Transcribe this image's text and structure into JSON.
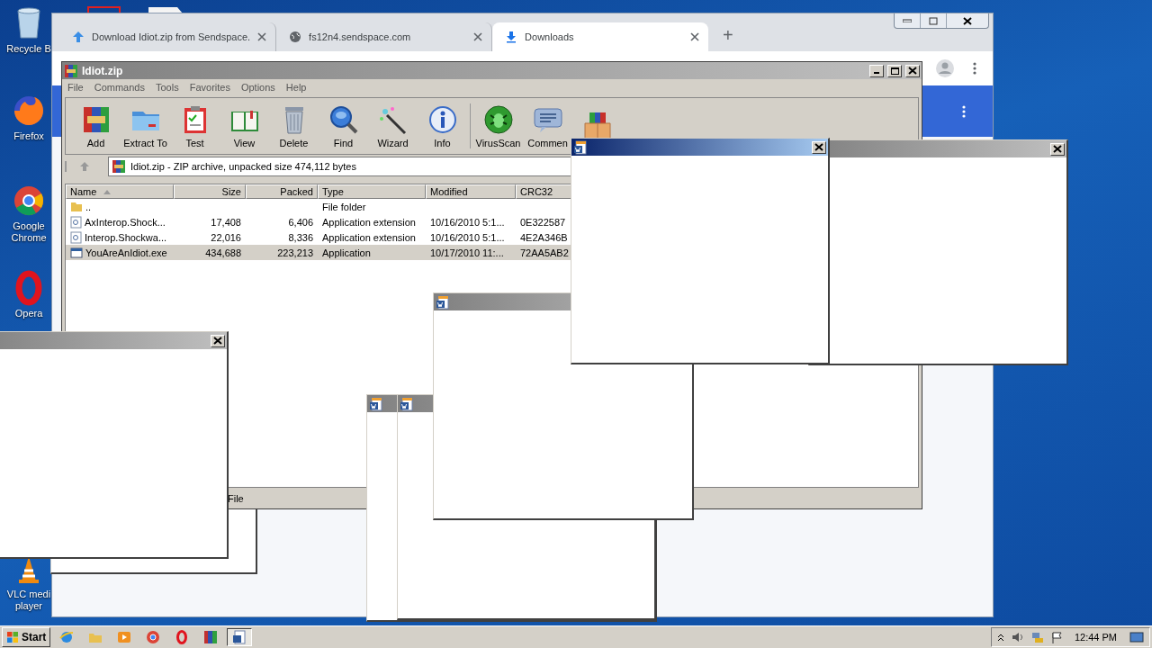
{
  "desktop_icons": [
    {
      "label": "Recycle B"
    },
    {
      "label": "Firefox"
    },
    {
      "label": "Google\nChrome"
    },
    {
      "label": "Opera"
    },
    {
      "label": "VLC medi\nplayer"
    }
  ],
  "browser": {
    "tabs": [
      {
        "title": "Download Idiot.zip from Sendspace.",
        "selected": false
      },
      {
        "title": "fs12n4.sendspace.com",
        "selected": false
      },
      {
        "title": "Downloads",
        "selected": true
      }
    ],
    "new_tab": "+"
  },
  "archiver": {
    "title": "Idiot.zip",
    "menu": [
      "File",
      "Commands",
      "Tools",
      "Favorites",
      "Options",
      "Help"
    ],
    "toolbar": [
      {
        "label": "Add"
      },
      {
        "label": "Extract To"
      },
      {
        "label": "Test"
      },
      {
        "label": "View"
      },
      {
        "label": "Delete"
      },
      {
        "label": "Find"
      },
      {
        "label": "Wizard"
      },
      {
        "label": "Info"
      },
      {
        "label": "VirusScan"
      },
      {
        "label": "Commen"
      },
      {
        "kind": "icon-only"
      }
    ],
    "path": "Idiot.zip - ZIP archive, unpacked size 474,112 bytes",
    "columns": [
      {
        "label": "Name",
        "sorted": true
      },
      {
        "label": "Size",
        "sorted": false
      },
      {
        "label": "Packed",
        "sorted": false
      },
      {
        "label": "Type",
        "sorted": false
      },
      {
        "label": "Modified",
        "sorted": false
      },
      {
        "label": "CRC32",
        "sorted": false
      }
    ],
    "rows": [
      {
        "kind": "folder",
        "name": "..",
        "type": "File folder",
        "selected": false
      },
      {
        "kind": "dll",
        "name": "AxInterop.Shock...",
        "size": "17,408",
        "packed": "6,406",
        "type": "Application extension",
        "modified": "10/16/2010 5:1...",
        "crc": "0E322587",
        "selected": false
      },
      {
        "kind": "dll",
        "name": "Interop.Shockwa...",
        "size": "22,016",
        "packed": "8,336",
        "type": "Application extension",
        "modified": "10/16/2010 5:1...",
        "crc": "4E2A346B",
        "selected": false
      },
      {
        "kind": "exe",
        "name": "YouAreAnIdiot.exe",
        "size": "434,688",
        "packed": "223,213",
        "type": "Application",
        "modified": "10/17/2010 11:...",
        "crc": "72AA5AB2",
        "selected": true
      }
    ],
    "status": "File"
  },
  "popups": [
    {
      "active": false
    },
    {
      "active": false
    },
    {
      "active": false
    },
    {
      "active": false
    },
    {
      "active": false
    },
    {
      "active": true
    }
  ],
  "taskbar": {
    "start": "Start",
    "items": [
      {
        "selected": false
      },
      {
        "selected": false
      },
      {
        "selected": false
      },
      {
        "selected": false
      },
      {
        "selected": false
      },
      {
        "selected": false
      },
      {
        "selected": true
      }
    ],
    "clock": "12:44 PM"
  }
}
